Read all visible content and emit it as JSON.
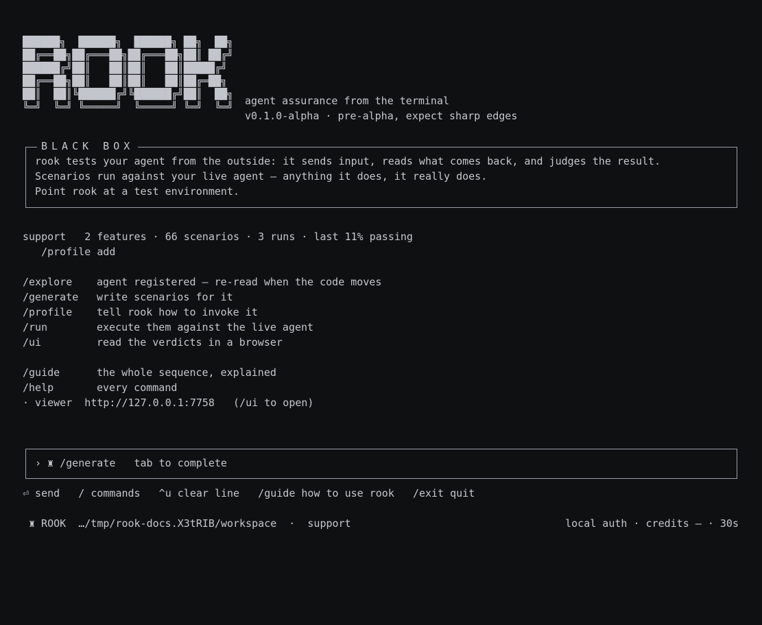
{
  "logo": {
    "lines": [
      "██████╗  ██████╗  ██████╗ ██╗  ██╗",
      "██╔══██╗██╔═══██╗██╔═══██╗██║ ██╔╝",
      "██████╔╝██║   ██║██║   ██║█████╔╝ ",
      "██╔══██╗██║   ██║██║   ██║██╔═██╗ ",
      "██║  ██║╚██████╔╝╚██████╔╝██║  ██╗",
      "╚═╝  ╚═╝ ╚═════╝  ╚═════╝ ╚═╝  ╚═╝"
    ]
  },
  "header": {
    "tagline": "agent assurance from the terminal",
    "version": "v0.1.0-alpha · pre-alpha, expect sharp edges"
  },
  "blackbox": {
    "title": "BLACK BOX",
    "lines": [
      "rook tests your agent from the outside: it sends input, reads what comes back, and judges the result.",
      "Scenarios run against your live agent — anything it does, it really does.",
      "Point rook at a test environment."
    ]
  },
  "project": {
    "summary": "support   2 features · 66 scenarios · 3 runs · last 11% passing",
    "hint": "   /profile add"
  },
  "commands": [
    {
      "cmd": "/explore",
      "desc": "agent registered — re-read when the code moves"
    },
    {
      "cmd": "/generate",
      "desc": "write scenarios for it"
    },
    {
      "cmd": "/profile",
      "desc": "tell rook how to invoke it"
    },
    {
      "cmd": "/run",
      "desc": "execute them against the live agent"
    },
    {
      "cmd": "/ui",
      "desc": "read the verdicts in a browser"
    }
  ],
  "extra_commands": [
    {
      "cmd": "/guide",
      "desc": "the whole sequence, explained"
    },
    {
      "cmd": "/help",
      "desc": "every command"
    }
  ],
  "viewer": "· viewer  http://127.0.0.1:7758   (/ui to open)",
  "prompt": {
    "text": "› ♜ /generate   tab to complete"
  },
  "keybar": "⏎ send   / commands   ^u clear line   /guide how to use rook   /exit quit",
  "statusbar": {
    "left": "♜ ROOK  …/tmp/rook-docs.X3tRIB/workspace  ·  support",
    "right": "local auth · credits — · 30s"
  }
}
